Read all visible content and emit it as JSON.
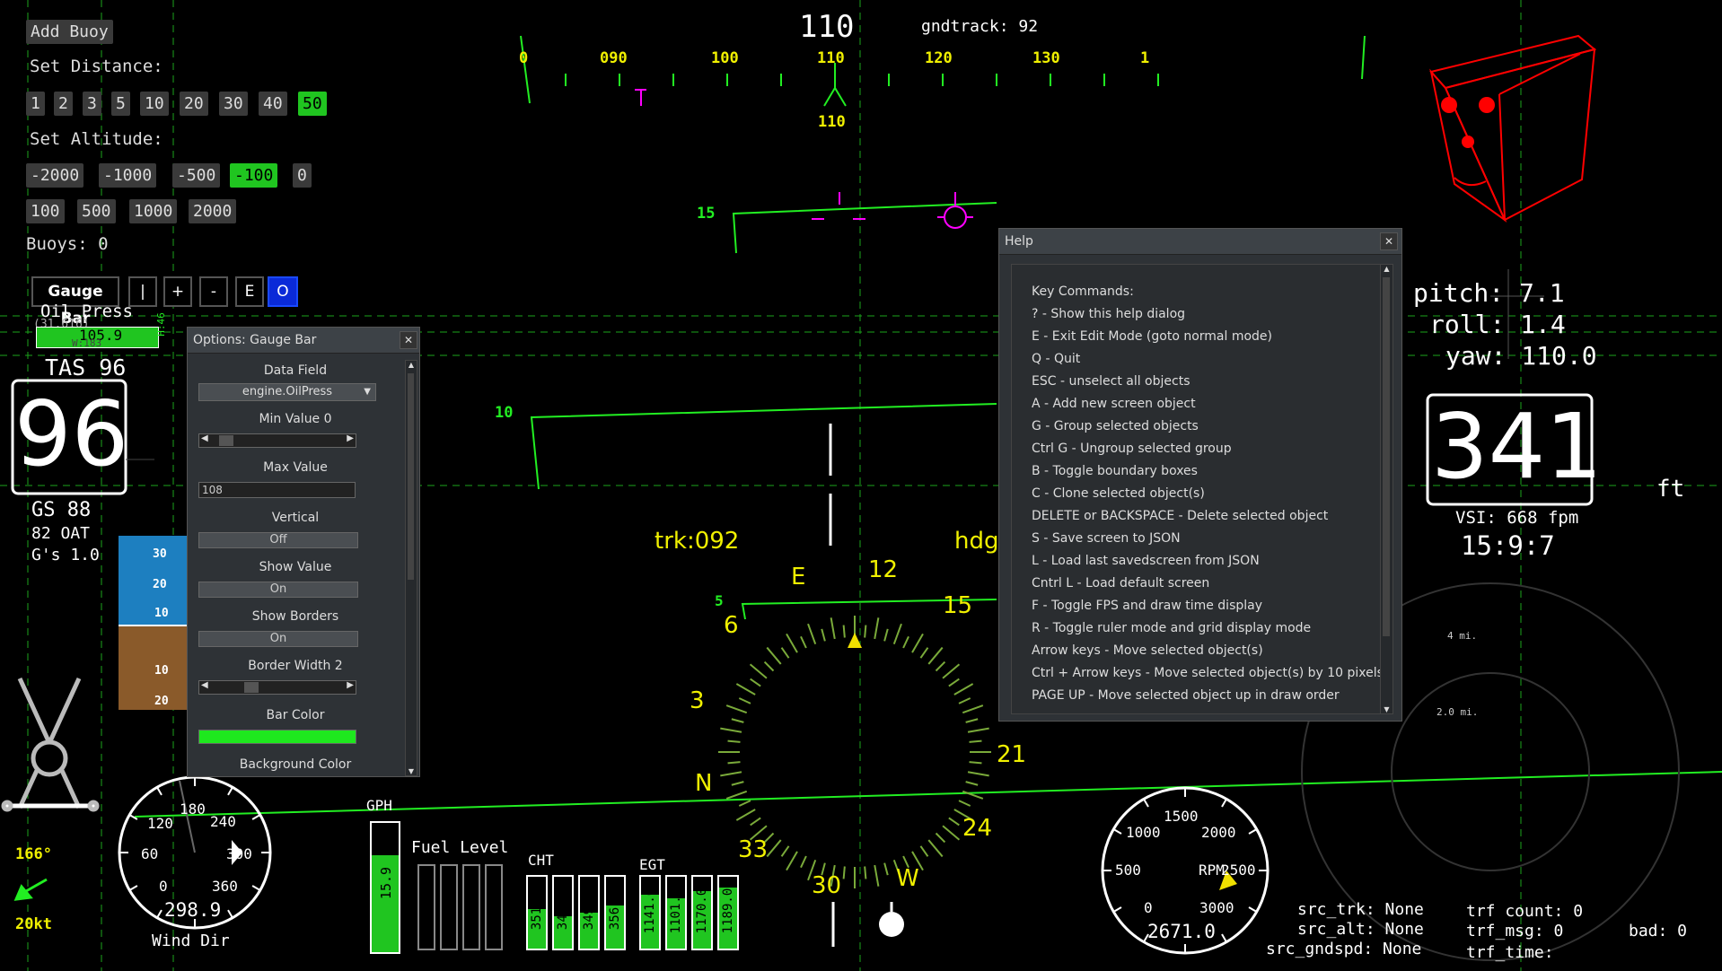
{
  "left_panel": {
    "add_buoy": "Add Buoy",
    "set_distance_label": "Set Distance:",
    "distances": [
      "1",
      "2",
      "3",
      "5",
      "10",
      "20",
      "30",
      "40",
      "50"
    ],
    "selected_distance": "50",
    "set_altitude_label": "Set Altitude:",
    "altitudes_row1": [
      "-2000",
      "-1000",
      "-500",
      "-100",
      "0"
    ],
    "altitudes_row2": [
      "100",
      "500",
      "1000",
      "2000"
    ],
    "selected_altitude": "-100",
    "buoys": "Buoys: 0"
  },
  "gauge_toolbar": {
    "name": "Gauge Bar",
    "buttons": [
      "|",
      "+",
      "-",
      "E",
      "O"
    ]
  },
  "oil_press": {
    "label": "Oil Press",
    "value": "105.9",
    "ghost_text": "(31,616)",
    "sub_text": "W:183",
    "side_text": "H:46"
  },
  "airspeed": {
    "tas": "TAS 96",
    "big": "96",
    "gs": "GS 88",
    "oat": "82 OAT",
    "gs_load": "G's 1.0"
  },
  "heading_tape": {
    "top_value": "110",
    "gndtrack": "gndtrack: 92",
    "ticks": [
      "0",
      "090",
      "100",
      "110",
      "120",
      "130",
      "1"
    ],
    "bug": "110"
  },
  "pitch_ladder": {
    "upper": "15",
    "lower": "10",
    "low5": "5"
  },
  "hsi": {
    "trk": "trk:092",
    "hdg": "hdg",
    "cardinals": [
      "E",
      "12",
      "15",
      "21",
      "24",
      "W",
      "30",
      "33",
      "N",
      "3",
      "6"
    ]
  },
  "attitude_mini": {
    "labels": [
      "30",
      "20",
      "10",
      "10",
      "20"
    ]
  },
  "attitude_readout": {
    "pitch": "pitch: 7.1",
    "roll": "roll: 1.4",
    "yaw": "yaw: 110.0"
  },
  "altimeter": {
    "big": "341",
    "unit": "ft",
    "vsi": "VSI: 668 fpm",
    "clock": "15:9:7"
  },
  "wind": {
    "heading_label": "166°",
    "speed": "20kt",
    "dial_labels": [
      "180",
      "240",
      "300",
      "360",
      "0",
      "60",
      "120"
    ],
    "value": "298.9",
    "caption": "Wind Dir"
  },
  "fuel": {
    "gph_label": "GPH",
    "gph_value": "15.9",
    "gph_fraction": 0.75,
    "fuel_label": "Fuel Level"
  },
  "cht": {
    "label": "CHT",
    "values": [
      "351.0",
      "343.0",
      "349.0",
      "356.0"
    ],
    "fractions": [
      0.55,
      0.45,
      0.5,
      0.6
    ]
  },
  "egt": {
    "label": "EGT",
    "values": [
      "1141.0",
      "1101.0",
      "1170.0",
      "1189.0"
    ],
    "fractions": [
      0.75,
      0.7,
      0.8,
      0.85
    ]
  },
  "rpm": {
    "labels": [
      "1500",
      "1000",
      "2000",
      "500",
      "2500",
      "0",
      "3000"
    ],
    "caption": "RPM",
    "value": "2671.0"
  },
  "traffic": {
    "src_trk": "src_trk: None",
    "src_alt": "src_alt: None",
    "src_gndspd": "src_gndspd: None",
    "trf_count": "trf count: 0",
    "trf_msg": "trf_msg: 0",
    "trf_time": "trf_time:",
    "bad": "bad: 0",
    "range_outer": "4 mi.",
    "range_inner": "2.0 mi."
  },
  "options_dialog": {
    "title": "Options: Gauge Bar",
    "data_field_label": "Data Field",
    "data_field_value": "engine.OilPress",
    "min_value_label": "Min Value 0",
    "max_value_label": "Max Value",
    "max_value": "108",
    "vertical_label": "Vertical",
    "vertical_value": "Off",
    "show_value_label": "Show Value",
    "show_value_value": "On",
    "show_borders_label": "Show Borders",
    "show_borders_value": "On",
    "border_width_label": "Border Width 2",
    "bar_color_label": "Bar Color",
    "bar_color": "#1ee81e",
    "background_color_label": "Background Color"
  },
  "help_dialog": {
    "title": "Help",
    "lines": [
      "Key Commands:",
      "? - Show this help dialog",
      "E - Exit Edit Mode (goto normal mode)",
      "Q - Quit",
      "ESC - unselect all objects",
      "A - Add new screen object",
      "G - Group selected objects",
      "Ctrl G - Ungroup selected group",
      "B - Toggle boundary boxes",
      "C - Clone selected object(s)",
      "DELETE or BACKSPACE - Delete selected object",
      "S - Save screen to JSON",
      "L - Load last savedscreen from JSON",
      "Cntrl L - Load default screen",
      "F - Toggle FPS and draw time display",
      "R - Toggle ruler mode and grid display mode",
      "Arrow keys - Move selected object(s)",
      "Ctrl + Arrow keys - Move selected object(s) by 10 pixels",
      "PAGE UP - Move selected object up in draw order"
    ]
  },
  "colors": {
    "hud_green": "#22ee22",
    "hud_yellow": "#f0f000",
    "magenta": "#ff00ff",
    "red": "#ff0000"
  }
}
